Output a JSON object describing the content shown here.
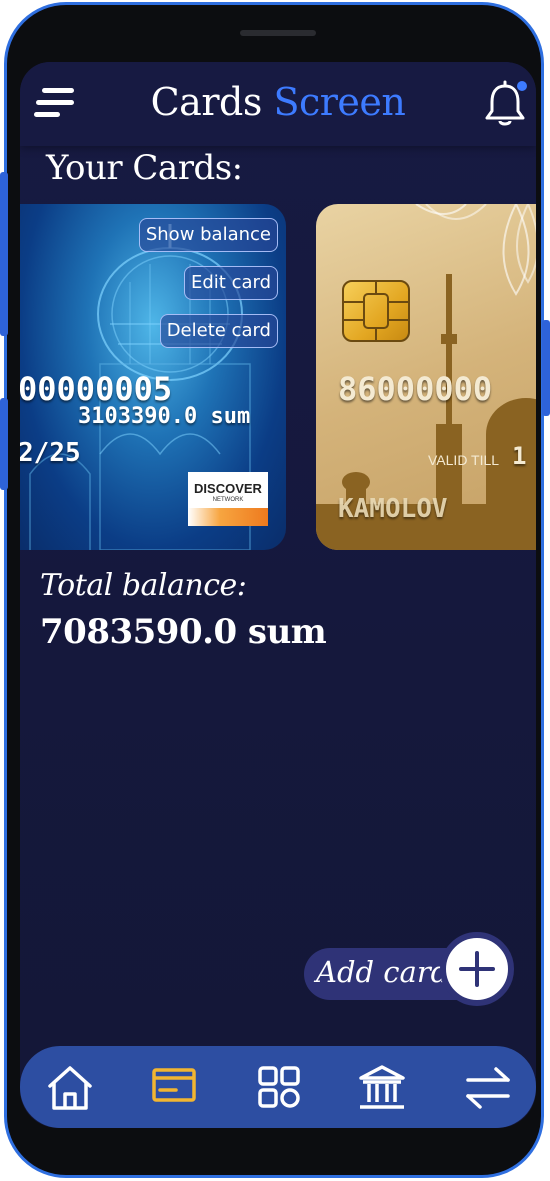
{
  "header": {
    "title_part1": "Cards",
    "title_part2": "Screen",
    "accent_color": "#3d7bff",
    "menu_icon": "hamburger-menu-icon",
    "notification_icon": "bell-icon",
    "notification_dot_color": "#3d7bff"
  },
  "section_title": "Your Cards:",
  "cards": [
    {
      "number": "00000005",
      "balance": "3103390.0 sum",
      "expiry": "2/25",
      "network": "DISCOVER",
      "network_sub": "NETWORK",
      "actions": {
        "show_balance": "Show balance",
        "edit": "Edit card",
        "delete": "Delete card"
      }
    },
    {
      "number": "86000000",
      "valid_till_label": "VALID TILL",
      "valid_till_value": "1",
      "holder": "KAMOLOV"
    }
  ],
  "total": {
    "label": "Total balance:",
    "value": "7083590.0 sum"
  },
  "add_card": {
    "label": "Add card:"
  },
  "nav": {
    "items": [
      "home-icon",
      "credit-card-icon",
      "apps-grid-icon",
      "bank-icon",
      "transfer-arrows-icon"
    ],
    "active_color": "#f2b531",
    "bar_color": "#2d4ea2"
  },
  "colors": {
    "background": "#15183d",
    "phone_frame_accent": "#2f6fe0"
  }
}
